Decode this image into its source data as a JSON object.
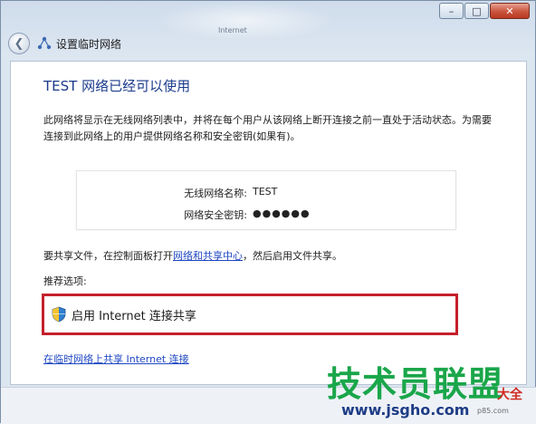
{
  "window": {
    "background_caption": "Internet",
    "nav_title": "设置临时网络"
  },
  "caption_buttons": {
    "minimize": "–",
    "maximize": "□",
    "close": "✕"
  },
  "content": {
    "heading": "TEST 网络已经可以使用",
    "description": "此网络将显示在无线网络列表中，并将在每个用户从该网络上断开连接之前一直处于活动状态。为需要连接到此网络上的用户提供网络名称和安全密钥(如果有)。",
    "network_name_label": "无线网络名称:",
    "network_name_value": "TEST",
    "security_key_label": "网络安全密钥:",
    "security_key_value": "●●●●●●",
    "share_prefix": "要共享文件，在控制面板打开",
    "share_link": "网络和共享中心",
    "share_suffix": "，然后启用文件共享。",
    "recommend_label": "推荐选项:",
    "ics_option": "启用 Internet 连接共享",
    "bottom_link": "在临时网络上共享 Internet 连接"
  },
  "watermark": {
    "main": "技术员联盟",
    "suffix": "大全",
    "url": "www.jsgho.com",
    "url_small": "p85.com"
  },
  "colors": {
    "heading": "#1a3a8b",
    "link": "#1f47c2",
    "highlight_border": "#c5202c",
    "watermark_green": "#1aa64a"
  }
}
